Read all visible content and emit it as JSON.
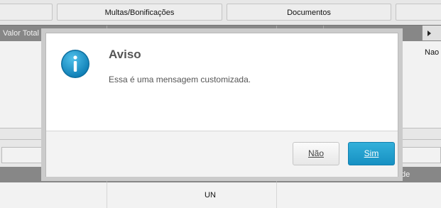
{
  "top_tabs": {
    "multas": "Multas/Bonificações",
    "documentos": "Documentos"
  },
  "grid": {
    "header_first_col": "Valor Total",
    "cell_nao": "Nao"
  },
  "grid2": {
    "header_right_col_partial": "de",
    "cell_un": "UN"
  },
  "dialog": {
    "title": "Aviso",
    "message": "Essa é uma mensagem customizada.",
    "no_label": "Não",
    "yes_label": "Sim"
  },
  "icons": {
    "info": "info-icon",
    "scroll_right": "triangle-right-icon"
  },
  "colors": {
    "header_gray": "#8e8e8e",
    "info_blue": "#1a8fc4",
    "button_blue": "#1e9fd0"
  }
}
